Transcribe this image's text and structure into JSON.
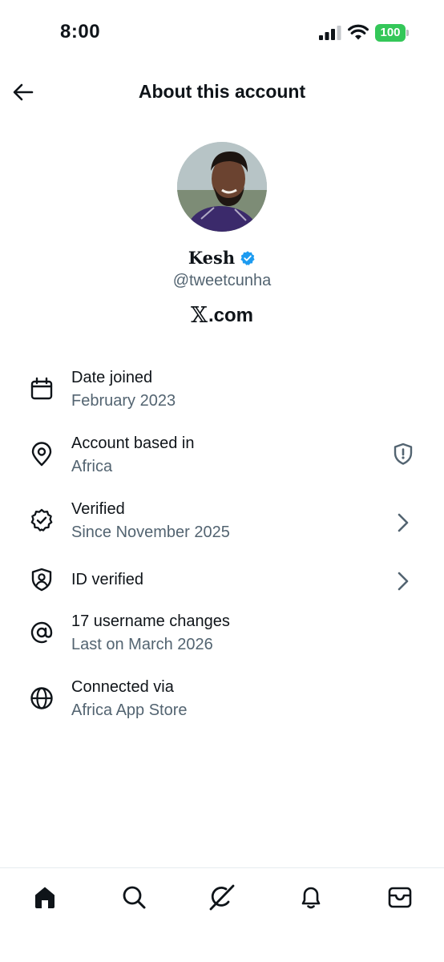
{
  "status_bar": {
    "time": "8:00",
    "battery": "100",
    "battery_color": "#34c759"
  },
  "header": {
    "title": "About this account",
    "back_icon": "arrow-left-icon"
  },
  "profile": {
    "name": "Kesh",
    "handle": "@tweetcunha",
    "site_mark": "𝕏",
    "site_domain": ".com",
    "verified_color": "#1d9bf0"
  },
  "info": [
    {
      "icon": "calendar-icon",
      "title": "Date joined",
      "subtitle": "February 2023"
    },
    {
      "icon": "location-pin-icon",
      "title": "Account based in",
      "subtitle": "Africa",
      "right_icon": "shield-alert-icon"
    },
    {
      "icon": "verified-badge-icon",
      "title": "Verified",
      "subtitle": "Since November 2025",
      "right_icon": "chevron-right-icon"
    },
    {
      "icon": "id-shield-icon",
      "title": "ID verified",
      "right_icon": "chevron-right-icon"
    },
    {
      "icon": "at-sign-icon",
      "title": "17 username changes",
      "subtitle": "Last on March 2026"
    },
    {
      "icon": "globe-icon",
      "title": "Connected via",
      "subtitle": "Africa App Store"
    }
  ],
  "bottom_nav": [
    "home-icon",
    "search-icon",
    "grok-icon",
    "notifications-icon",
    "messages-icon"
  ],
  "colors": {
    "text": "#0f1419",
    "secondary": "#536471",
    "accent": "#1d9bf0"
  }
}
